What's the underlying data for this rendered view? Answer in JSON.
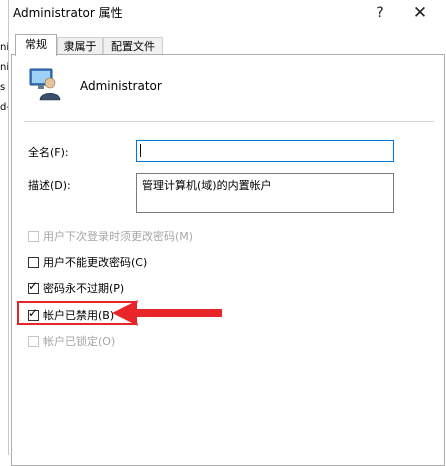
{
  "background_fragments": [
    "ni",
    "ni",
    "s",
    "d-"
  ],
  "title_bar": {
    "title": "Administrator 属性",
    "help_icon": "?",
    "close_icon": "✕"
  },
  "tabs": [
    {
      "label": "常规",
      "active": true
    },
    {
      "label": "隶属于",
      "active": false
    },
    {
      "label": "配置文件",
      "active": false
    }
  ],
  "user": {
    "icon": "user-computer-icon",
    "name": "Administrator"
  },
  "fields": {
    "fullname": {
      "label": "全名(F):",
      "value": ""
    },
    "description": {
      "label": "描述(D):",
      "value": "管理计算机(域)的内置帐户"
    }
  },
  "checkboxes": [
    {
      "label": "用户下次登录时须更改密码(M)",
      "checked": false,
      "enabled": false
    },
    {
      "label": "用户不能更改密码(C)",
      "checked": false,
      "enabled": true
    },
    {
      "label": "密码永不过期(P)",
      "checked": true,
      "enabled": true
    },
    {
      "label": "帐户已禁用(B)",
      "checked": true,
      "enabled": true
    },
    {
      "label": "帐户已锁定(O)",
      "checked": false,
      "enabled": false
    }
  ],
  "annotation": {
    "color": "#e8262a",
    "points_to": "帐户已禁用(B)"
  }
}
